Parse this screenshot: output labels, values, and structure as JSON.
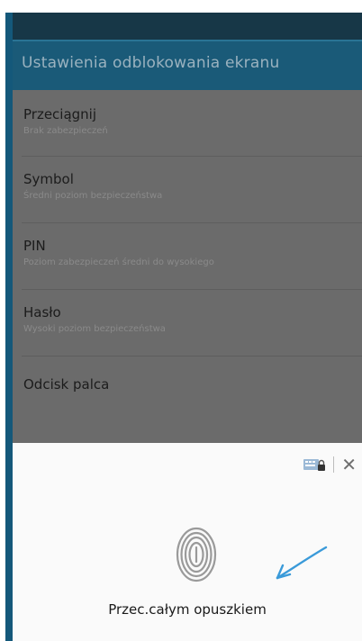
{
  "appbar": {
    "title": "Ustawienia odblokowania ekranu"
  },
  "options": [
    {
      "title": "Przeciągnij",
      "subtitle": "Brak zabezpieczeń"
    },
    {
      "title": "Symbol",
      "subtitle": "Średni poziom bezpieczeństwa"
    },
    {
      "title": "PIN",
      "subtitle": "Poziom zabezpieczeń średni do wysokiego"
    },
    {
      "title": "Hasło",
      "subtitle": "Wysoki poziom bezpieczeństwa"
    },
    {
      "title": "Odcisk palca",
      "subtitle": ""
    }
  ],
  "sheet": {
    "instruction": "Przec.całym opuszkiem",
    "icons": [
      "keyboard-lock-icon",
      "close-icon"
    ],
    "close_glyph": "✕"
  },
  "colors": {
    "appbar": "#1a5a78",
    "dim_overlay": "#6b6b6b",
    "accent_arrow": "#3a9ad9"
  }
}
